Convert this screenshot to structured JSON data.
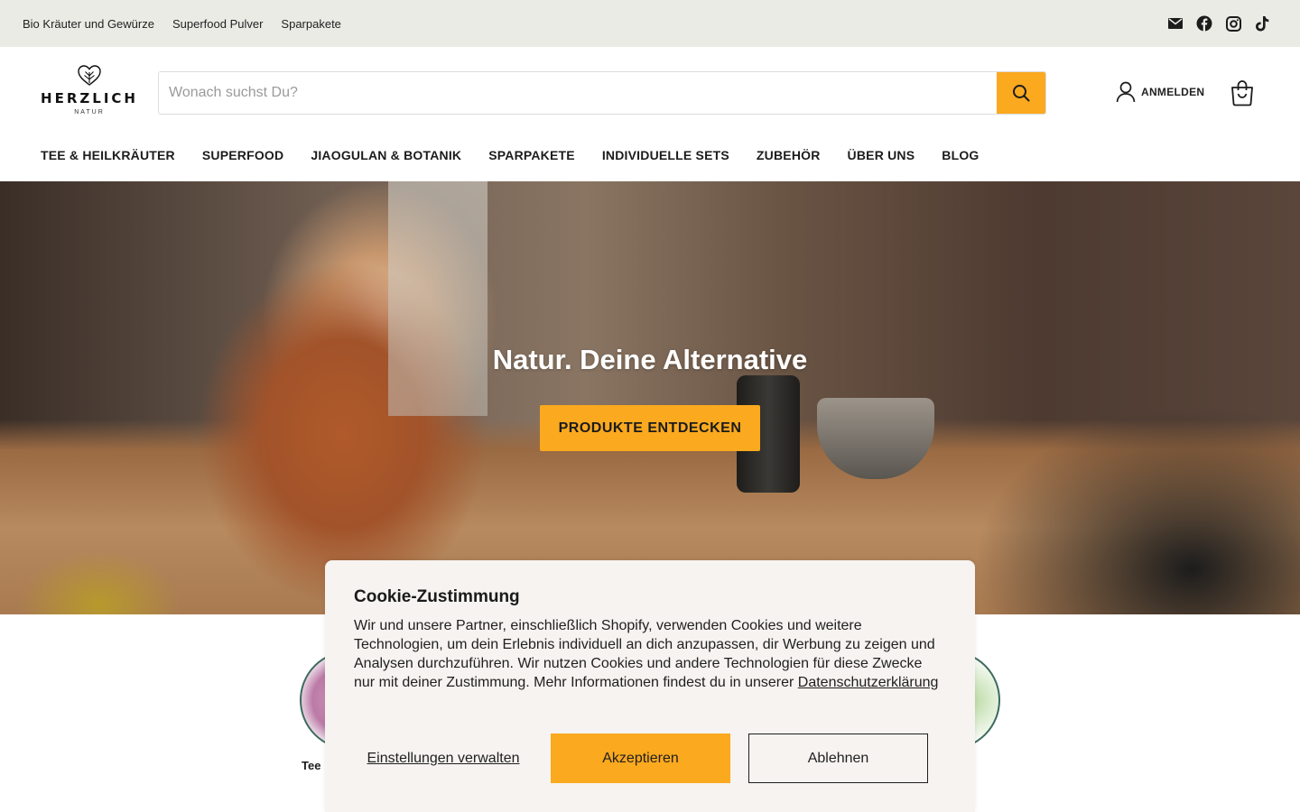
{
  "topbar": {
    "links": [
      "Bio Kräuter und Gewürze",
      "Superfood Pulver",
      "Sparpakete"
    ],
    "social_icons": [
      "mail-icon",
      "facebook-icon",
      "instagram-icon",
      "tiktok-icon"
    ]
  },
  "header": {
    "logo_word": "HERZLICH",
    "logo_sub": "NATUR",
    "search_placeholder": "Wonach suchst Du?",
    "account_label": "ANMELDEN"
  },
  "nav": {
    "items": [
      "TEE & HEILKRÄUTER",
      "SUPERFOOD",
      "JIAOGULAN & BOTANIK",
      "SPARPAKETE",
      "INDIVIDUELLE SETS",
      "ZUBEHÖR",
      "ÜBER UNS",
      "BLOG"
    ]
  },
  "hero": {
    "title": "Natur. Deine Alternative",
    "cta": "PRODUKTE ENTDECKEN"
  },
  "categories": {
    "first_label": "Tee"
  },
  "cookie": {
    "title": "Cookie-Zustimmung",
    "body": "Wir und unsere Partner, einschließlich Shopify, verwenden Cookies und weitere Technologien, um dein Erlebnis individuell an dich anzupassen, dir Werbung zu zeigen und Analysen durchzuführen. Wir nutzen Cookies und andere Technologien für diese Zwecke nur mit deiner Zustimmung. Mehr Informationen findest du in unserer ",
    "privacy_link": "Datenschutzerklärung",
    "manage": "Einstellungen verwalten",
    "accept": "Akzeptieren",
    "decline": "Ablehnen"
  },
  "colors": {
    "accent": "#fba91f",
    "topbar_bg": "#ebebe5",
    "cookie_bg": "#f6f3f0",
    "circle_border": "#3d6b5e"
  }
}
